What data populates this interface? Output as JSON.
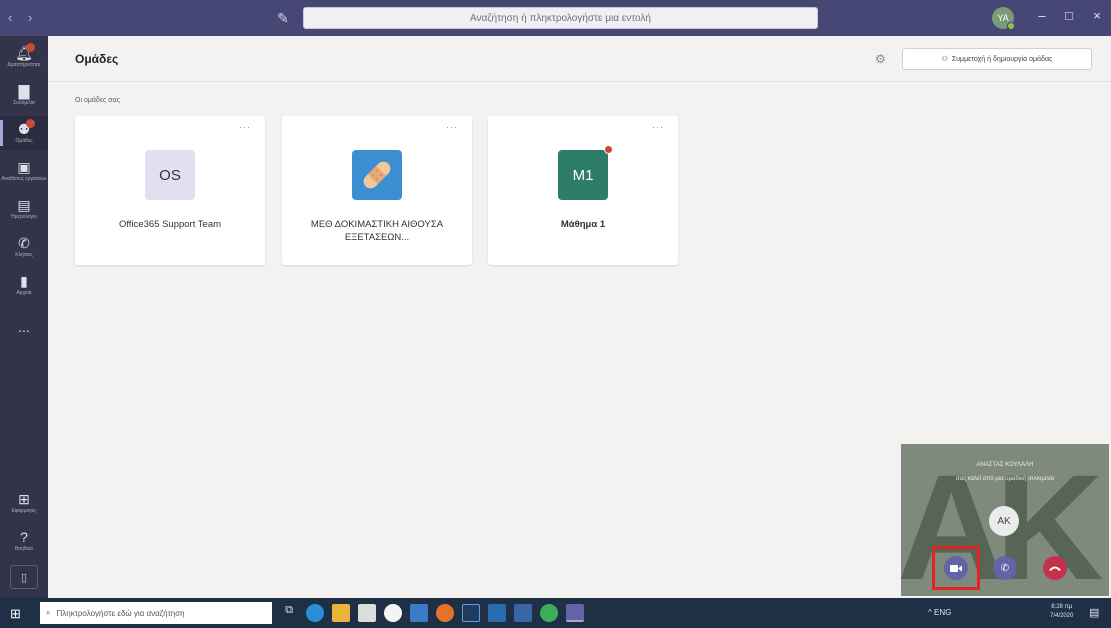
{
  "titlebar": {
    "nav_arrows": "‹ ›",
    "search_placeholder": "Αναζήτηση ή πληκτρολογήστε μια εντολή",
    "profile_initials": "ΥΑ",
    "minimize": "–",
    "maximize": "□",
    "close": "×"
  },
  "rail": {
    "items": [
      {
        "label": "Δραστηριότητα",
        "icon": "bell-icon",
        "badge": true
      },
      {
        "label": "Συνομιλία",
        "icon": "chat-icon",
        "badge": false
      },
      {
        "label": "Ομάδες",
        "icon": "teams-icon",
        "badge": true,
        "active": true
      },
      {
        "label": "Αναθέσεις εργασιών",
        "icon": "assignments-icon",
        "badge": false
      },
      {
        "label": "Ημερολόγιο",
        "icon": "calendar-icon",
        "badge": false
      },
      {
        "label": "Κλήσεις",
        "icon": "phone-icon",
        "badge": false
      },
      {
        "label": "Αρχεία",
        "icon": "files-icon",
        "badge": false
      },
      {
        "label": "...",
        "icon": "more-icon",
        "badge": false
      }
    ],
    "bottom": [
      {
        "label": "Εφαρμογές",
        "icon": "apps-icon"
      },
      {
        "label": "Βοήθεια",
        "icon": "help-icon"
      }
    ]
  },
  "header": {
    "title": "Ομάδες",
    "join_button": "Συμμετοχή ή δημιουργία ομάδας"
  },
  "section_label": "Οι ομάδες σας",
  "teams": [
    {
      "initials": "OS",
      "name": "Office365 Support Team",
      "bold": false
    },
    {
      "initials": "",
      "name": "ΜΕΘ ΔΟΚΙΜΑΣΤΙΚΗ ΑΙΘΟΥΣΑ ΕΞΕΤΑΣΕΩΝ...",
      "bold": false
    },
    {
      "initials": "M1",
      "name": "Μάθημα 1",
      "bold": true
    }
  ],
  "card_more": "···",
  "call": {
    "caller": "ΑΝΑΣΤΑΣ ΚΟΥΛΑΛΗ",
    "subtitle": "σας καλεί από μια ομαδική συνομιλία",
    "initials": "AK",
    "background_letters": "AK"
  },
  "taskbar": {
    "search_placeholder": "Πληκτρολογήστε εδώ για αναζήτηση",
    "tray_text": "^ ENG",
    "clock_time": "8:28 πμ",
    "clock_date": "7/4/2020"
  },
  "colors": {
    "titlebar": "#464775",
    "rail": "#33344a",
    "accent": "#6264a7",
    "hangup": "#c4314b",
    "highlight": "#e02424"
  }
}
